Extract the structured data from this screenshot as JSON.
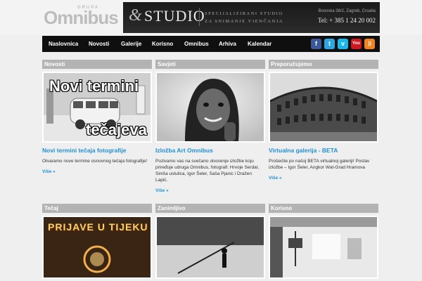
{
  "header": {
    "logo_small": "GRUPA",
    "logo_big": "Omnibus",
    "banner_amp": "&",
    "banner_studio": "STUDIO",
    "banner_tag1": "SPECIJALIZIRANI STUDIO",
    "banner_tag2": "ZA SNIMANJE VJENČANJA",
    "banner_address": "Bosnska 38/2, Zagreb, Croatia",
    "banner_tel": "Tel: + 385 1 24 20 002"
  },
  "nav": {
    "items": [
      "Naslovnica",
      "Novosti",
      "Galerije",
      "Korisno",
      "Omnibus",
      "Arhiva",
      "Kalendar"
    ]
  },
  "social": [
    {
      "icon": "facebook-icon",
      "glyph": "f",
      "color": "#3b5998"
    },
    {
      "icon": "twitter-icon",
      "glyph": "t",
      "color": "#2ea7e0"
    },
    {
      "icon": "vimeo-icon",
      "glyph": "v",
      "color": "#1ab7ea"
    },
    {
      "icon": "youtube-icon",
      "glyph": "You",
      "color": "#cc181e"
    },
    {
      "icon": "rss-icon",
      "glyph": "))",
      "color": "#f18322"
    }
  ],
  "columns": [
    {
      "heading": "Novosti",
      "thumb_text1": "Novi termini",
      "thumb_text2": "tečajeva",
      "title": "Novi termini tečaja fotografije",
      "body": "Otvaramo nove termine osnovnog tečaja fotografije!",
      "more": "Više »"
    },
    {
      "heading": "Savjeti",
      "title": "Izložba Art Omnibus",
      "body": "Pozivamo vas na svečano otvorenje izložbe koju priređuje udruga Omnibus, fotografi: Hrvoje Serdar, Siniša ustulica, Igor Šeler, Saša Pjanic i Dražen Lapić.",
      "more": "Više »"
    },
    {
      "heading": "Preporučujemo",
      "title": "Virtualna galerija - BETA",
      "body": "Prošećite po našoj BETA virtualnoj galeriji! Postav izložbe – Igor Šeler, Angkor Wat-Grad Hramova",
      "more": "Više »"
    }
  ],
  "row2": [
    {
      "heading": "Tečaj",
      "thumb_text": "PRIJAVE U TIJEKU"
    },
    {
      "heading": "Zanimljivo"
    },
    {
      "heading": "Korisno"
    }
  ]
}
